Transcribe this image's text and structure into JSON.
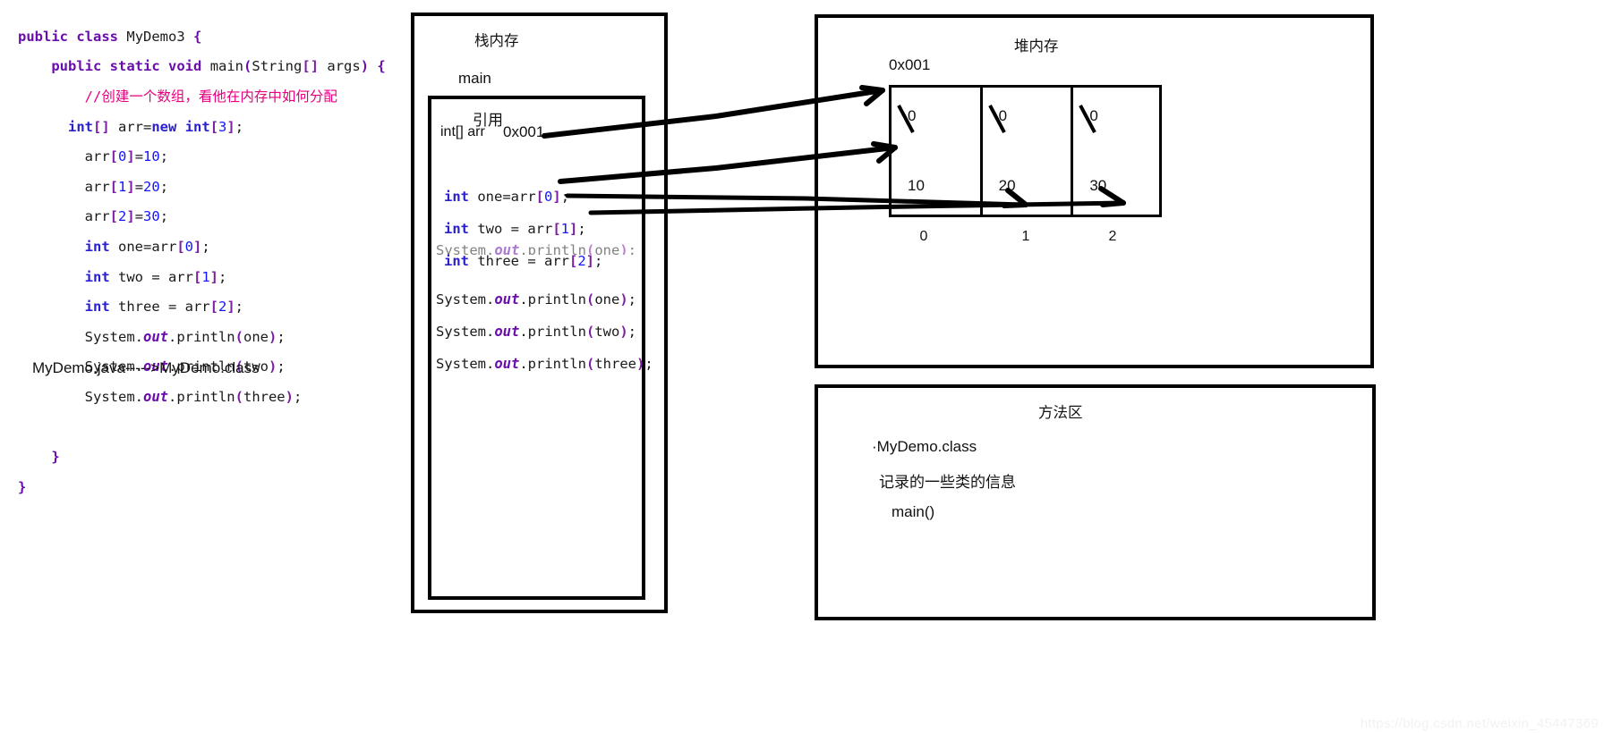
{
  "source_code": {
    "lines": [
      "public class MyDemo3 {",
      "    public static void main(String[] args) {",
      "        //创建一个数组，看他在内存中如何分配",
      "      int[] arr=new int[3];",
      "        arr[0]=10;",
      "        arr[1]=20;",
      "        arr[2]=30;",
      "        int one=arr[0];",
      "        int two = arr[1];",
      "        int three = arr[2];",
      "        System.out.println(one);",
      "        System.out.println(two);",
      "        System.out.println(three);",
      "",
      "    }",
      "}"
    ]
  },
  "file_note": "MyDemo.java----->MyDemo.class",
  "stack": {
    "title": "栈内存",
    "frame_name": "main",
    "reference_label": "引用",
    "reference_decl": "int[] arr",
    "reference_value": "0x001",
    "code_lines": [
      "int one=arr[0];",
      "int two = arr[1];",
      "int three = arr[2];"
    ],
    "print_lines": [
      "System.out.println(one);",
      "System.out.println(two);",
      "System.out.println(three);"
    ]
  },
  "heap": {
    "title": "堆内存",
    "address": "0x001",
    "cells": [
      {
        "old_value": "0",
        "new_value": "10",
        "index": "0"
      },
      {
        "old_value": "0",
        "new_value": "20",
        "index": "1"
      },
      {
        "old_value": "0",
        "new_value": "30",
        "index": "2"
      }
    ]
  },
  "method_area": {
    "title": "方法区",
    "class_entry": "·MyDemo.class",
    "note": "记录的一些类的信息",
    "method_entry": "main()"
  },
  "watermark": "https://blog.csdn.net/weixin_45447369",
  "colors": {
    "keyword": "#6a0dad",
    "keyword_blue": "#2b20d0",
    "comment": "#e6007e",
    "number": "#1414ff",
    "bracket": "#7b1fa2",
    "outline": "#000000",
    "background": "#ffffff"
  }
}
